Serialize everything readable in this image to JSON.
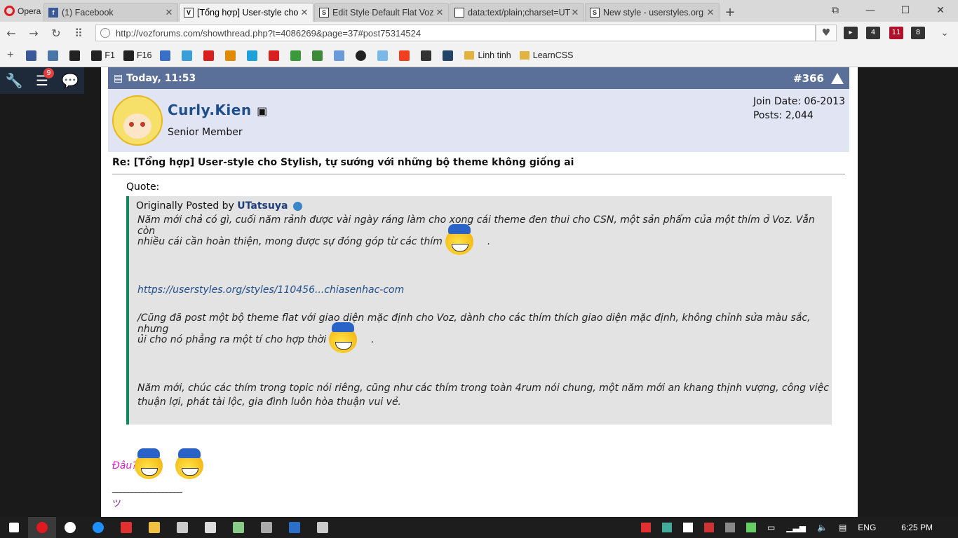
{
  "browser": {
    "menu_label": "Opera",
    "tabs": [
      {
        "title": "(1) Facebook",
        "icon": "facebook-icon"
      },
      {
        "title": "[Tổng hợp] User-style cho",
        "icon": "voz-icon",
        "active": true
      },
      {
        "title": "Edit Style Default Flat Voz",
        "icon": "stylish-icon"
      },
      {
        "title": "data:text/plain;charset=UT",
        "icon": "document-icon"
      },
      {
        "title": "New style - userstyles.org",
        "icon": "stylish-icon"
      }
    ],
    "url": "http://vozforums.com/showthread.php?t=4086269&page=37#post75314524",
    "extension_badges": [
      "4",
      "11",
      "8"
    ],
    "bookmarks": [
      {
        "label": "",
        "color": "#3b5998"
      },
      {
        "label": "",
        "color": "#4a76a8"
      },
      {
        "label": "",
        "color": "#222222"
      },
      {
        "label": "F1",
        "color": "#222222"
      },
      {
        "label": "F16",
        "color": "#222222"
      },
      {
        "label": "",
        "color": "#3a6fc8"
      },
      {
        "label": "",
        "color": "#3a9fd8"
      },
      {
        "label": "",
        "color": "#d82020"
      },
      {
        "label": "",
        "color": "#e08a00"
      },
      {
        "label": "",
        "color": "#1ea0d8"
      },
      {
        "label": "",
        "color": "#d82020"
      },
      {
        "label": "",
        "color": "#3a9a3a"
      },
      {
        "label": "",
        "color": "#3a8a3a"
      },
      {
        "label": "",
        "color": "#6a9ad8"
      },
      {
        "label": "",
        "color": "#222222"
      },
      {
        "label": "",
        "color": "#7ab8e8"
      },
      {
        "label": "",
        "color": "#f04020"
      },
      {
        "label": "",
        "color": "#333333"
      },
      {
        "label": "",
        "color": "#224466"
      },
      {
        "label": "Linh tinh",
        "folder": true
      },
      {
        "label": "LearnCSS",
        "folder": true
      }
    ]
  },
  "sidebar": {
    "notif_count": "9"
  },
  "post": {
    "date": "Today, 11:53",
    "number": "#366",
    "username": "Curly.Kien",
    "user_title": "Senior Member",
    "join_date": "Join Date: 06-2013",
    "posts": "Posts: 2,044",
    "title": "Re: [Tổng hợp] User-style cho Stylish, tự sướng với những bộ theme không giống ai",
    "quote_label": "Quote:",
    "quote": {
      "by_prefix": "Originally Posted by",
      "author": "UTatsuya",
      "line1": "Năm mới chả có gì, cuối năm rảnh được vài ngày ráng làm cho xong cái theme đen thui cho CSN, một sản phẩm của một thím ở Voz. Vẫn còn",
      "line2": "nhiều cái cần hoàn thiện, mong được sự đóng góp từ các thím",
      "link": "https://userstyles.org/styles/110456...chiasenhac-com",
      "line3": "/Cũng đã post một bộ theme flat với giao diện mặc định cho Voz, dành cho các thím thích giao diện mặc định, không chỉnh sửa màu sắc, nhưng",
      "line4": "ủi cho nó phẳng ra một tí cho hợp thời",
      "line5": "Năm mới, chúc các thím trong topic nói riêng, cũng như các thím trong toàn 4rum nói chung, một năm mới an khang thịnh vượng, công việc",
      "line6": "thuận lợi, phát tài lộc, gia đình luôn hòa thuận vui vẻ.",
      "dot": "."
    },
    "reply": "Đâu?",
    "signature_line": "__________________",
    "signature": "ツ"
  },
  "taskbar": {
    "apps": [
      {
        "icon": "windows-icon",
        "color": "#ffffff"
      },
      {
        "icon": "opera-icon",
        "color": "#e0191f"
      },
      {
        "icon": "yandex-icon",
        "color": "#ffffff"
      },
      {
        "icon": "ie-icon",
        "color": "#1e90ff"
      },
      {
        "icon": "vivaldi-icon",
        "color": "#e03030"
      },
      {
        "icon": "explorer-icon",
        "color": "#f0c040"
      },
      {
        "icon": "app-icon",
        "color": "#cccccc"
      },
      {
        "icon": "app-icon",
        "color": "#dddddd"
      },
      {
        "icon": "app-icon",
        "color": "#88cc88"
      },
      {
        "icon": "app-icon",
        "color": "#aaaaaa"
      },
      {
        "icon": "photoshop-icon",
        "color": "#2a6fc8"
      },
      {
        "icon": "calculator-icon",
        "color": "#cccccc"
      }
    ],
    "lang": "ENG",
    "time": "6:25 PM"
  }
}
